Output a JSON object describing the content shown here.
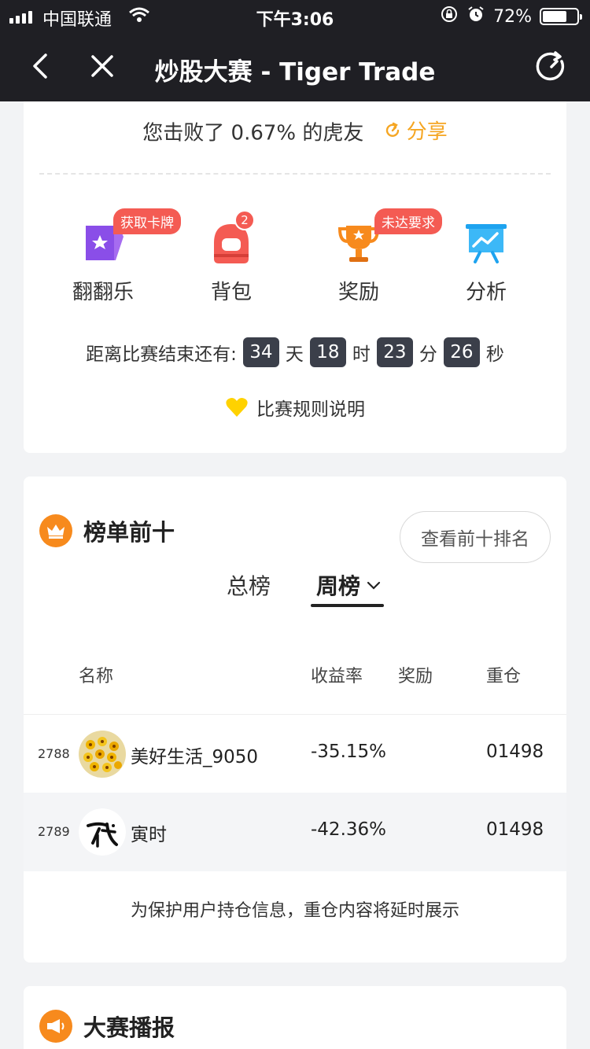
{
  "status": {
    "carrier": "中国联通",
    "time": "下午3:06",
    "battery": "72%",
    "battery_level": 0.72
  },
  "nav": {
    "title": "炒股大赛 - Tiger Trade"
  },
  "summary": {
    "beat_text": "您击败了 0.67% 的虎友",
    "share_label": "分享"
  },
  "features": [
    {
      "label": "翻翻乐",
      "badge": "获取卡牌"
    },
    {
      "label": "背包",
      "badge_count": "2"
    },
    {
      "label": "奖励",
      "badge": "未达要求"
    },
    {
      "label": "分析"
    }
  ],
  "countdown": {
    "prefix": "距离比赛结束还有:",
    "days": "34",
    "days_unit": "天",
    "hours": "18",
    "hours_unit": "时",
    "minutes": "23",
    "minutes_unit": "分",
    "seconds": "26",
    "seconds_unit": "秒"
  },
  "rules_label": "比赛规则说明",
  "leaderboard": {
    "title": "榜单前十",
    "top10_button": "查看前十排名",
    "tabs": {
      "total": "总榜",
      "week": "周榜"
    },
    "columns": {
      "name": "名称",
      "yield": "收益率",
      "reward": "奖励",
      "position": "重仓"
    },
    "rows": [
      {
        "rank": "2788",
        "name": "美好生活_9050",
        "yield": "-35.15%",
        "reward": "",
        "position": "01498"
      },
      {
        "rank": "2789",
        "name": "寅时",
        "yield": "-42.36%",
        "reward": "",
        "position": "01498"
      }
    ],
    "notice": "为保护用户持仓信息，重仓内容将延时展示"
  },
  "broadcast": {
    "title": "大赛播报"
  },
  "colors": {
    "nav_bg": "#1f1f24",
    "accent_orange": "#f78a1d",
    "share_orange": "#f5a623",
    "badge_red": "#f45b53"
  }
}
